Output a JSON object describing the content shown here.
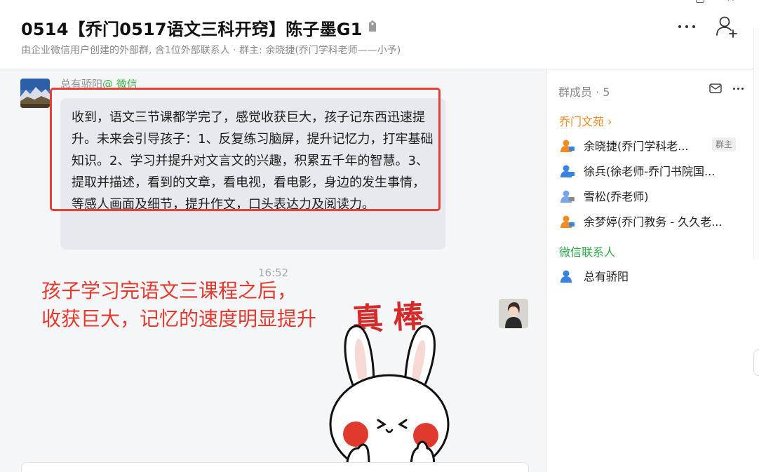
{
  "header": {
    "title": "0514【乔门0517语文三科开窍】陈子墨G1",
    "subtitle": "由企业微信用户创建的外部群, 含1位外部联系人 · 群主: 余晓捷(乔门学科老师——小予)"
  },
  "message": {
    "sender_name": "总有骄阳",
    "sender_source": "@ 微信",
    "text": "收到，语文三节课都学完了，感觉收获巨大，孩子记东西迅速提升。未来会引导孩子：1、反复练习脑屏，提升记忆力，打牢基础知识。2、学习并提升对文言文的兴趣，积累五千年的智慧。3、提取并描述，看到的文章，看电视，看电影，身边的发生事情，等感人画面及细节，提升作文，口头表达力及阅读力。",
    "timestamp": "16:52"
  },
  "annotation": {
    "text": "孩子学习完语文三课程之后，\n收获巨大，记忆的速度明显提升"
  },
  "sticker": {
    "caption": "真棒",
    "icon": "bunny-thumbs-up-sticker"
  },
  "panel": {
    "title": "群成员 · 5",
    "group_name": "乔门文苑 ›",
    "members": [
      {
        "name": "余晓捷(乔门学科老...",
        "badge": "群主",
        "icon": "member-orange-icon"
      },
      {
        "name": "徐兵(徐老师-乔门书院国...",
        "icon": "member-blue-pc-icon"
      },
      {
        "name": "雪松(乔老师)",
        "icon": "member-blue-pc-icon"
      },
      {
        "name": "余梦婷(乔门教务 - 久久老...",
        "icon": "member-orange-icon"
      }
    ],
    "wechat_section": "微信联系人",
    "wechat_members": [
      {
        "name": "总有骄阳",
        "icon": "member-blue-icon"
      }
    ]
  },
  "colors": {
    "accent_orange": "#f08a24",
    "wechat_green": "#2faa4b",
    "highlight_red": "#e5413b",
    "bubble": "#e7e9ee"
  }
}
